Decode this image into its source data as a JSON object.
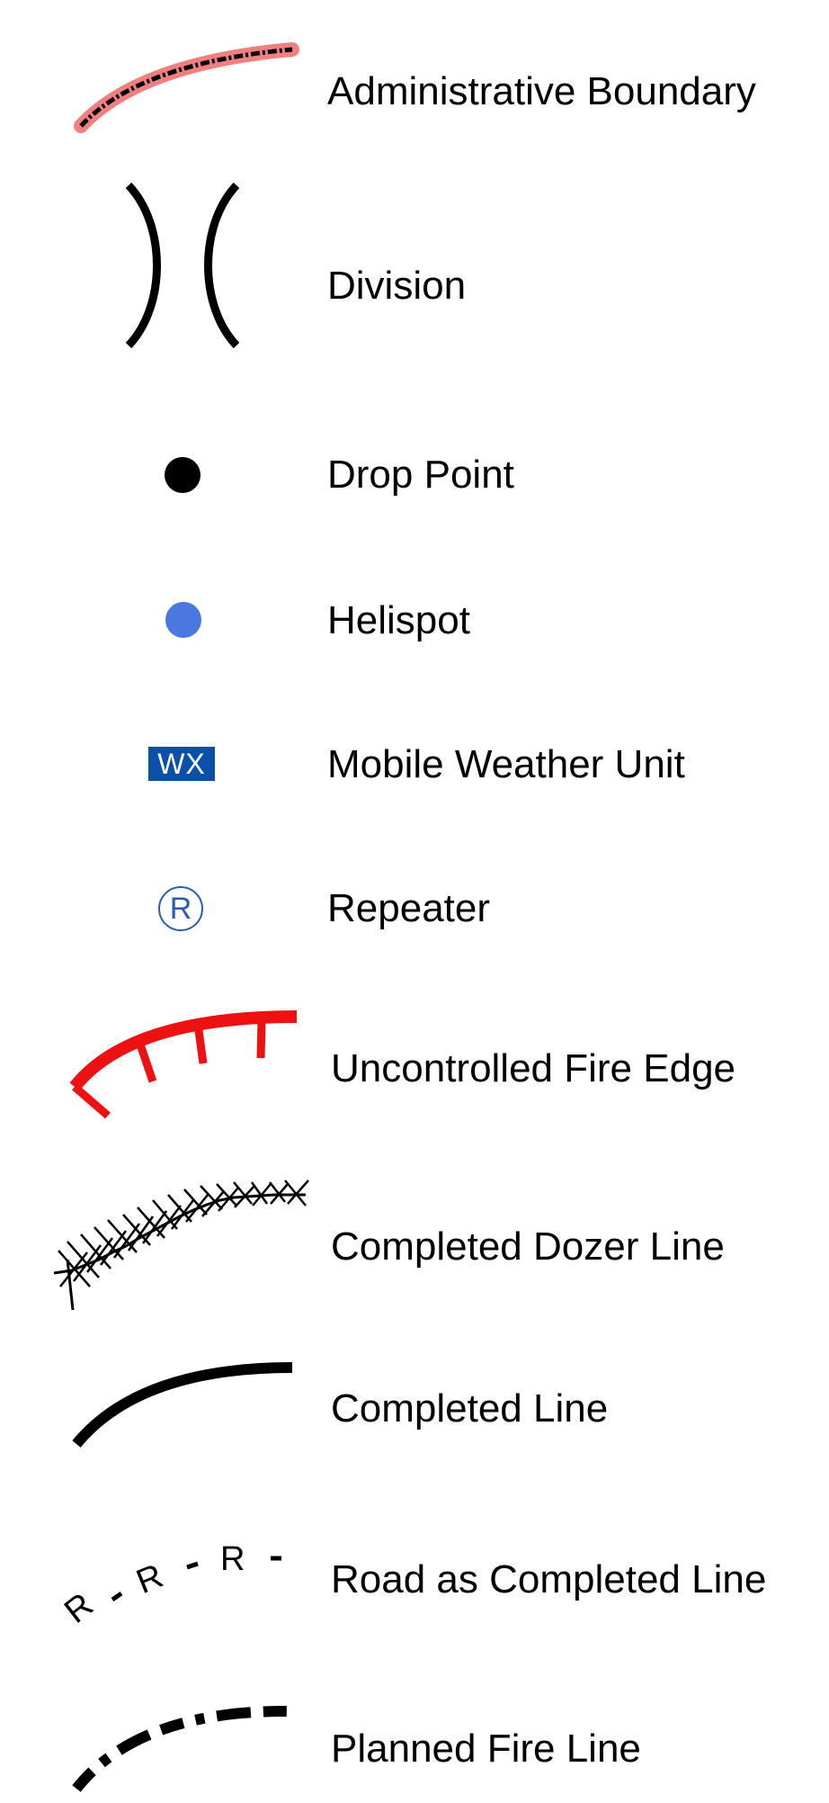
{
  "legend": {
    "items": [
      {
        "label": "Administrative Boundary",
        "icon": "administrative-boundary-icon",
        "colors": {
          "band": "#f08080",
          "line": "#000000"
        }
      },
      {
        "label": "Division",
        "icon": "division-icon",
        "colors": {
          "stroke": "#000000"
        }
      },
      {
        "label": "Drop Point",
        "icon": "drop-point-icon",
        "colors": {
          "fill": "#000000"
        }
      },
      {
        "label": "Helispot",
        "icon": "helispot-icon",
        "colors": {
          "fill": "#4a78e0"
        }
      },
      {
        "label": "Mobile Weather Unit",
        "icon": "mobile-weather-unit-icon",
        "badge_text": "WX",
        "colors": {
          "fill": "#0a4fa8",
          "text": "#ffffff"
        }
      },
      {
        "label": "Repeater",
        "icon": "repeater-icon",
        "glyph": "R",
        "colors": {
          "stroke": "#2a5db0"
        }
      },
      {
        "label": "Uncontrolled Fire Edge",
        "icon": "uncontrolled-fire-edge-icon",
        "colors": {
          "stroke": "#ee1111"
        }
      },
      {
        "label": "Completed Dozer Line",
        "icon": "completed-dozer-line-icon",
        "colors": {
          "stroke": "#000000"
        }
      },
      {
        "label": "Completed Line",
        "icon": "completed-line-icon",
        "colors": {
          "stroke": "#000000"
        }
      },
      {
        "label": "Road as Completed Line",
        "icon": "road-as-completed-line-icon",
        "glyph": "R",
        "colors": {
          "stroke": "#000000"
        }
      },
      {
        "label": "Planned Fire Line",
        "icon": "planned-fire-line-icon",
        "colors": {
          "stroke": "#000000"
        }
      }
    ]
  }
}
